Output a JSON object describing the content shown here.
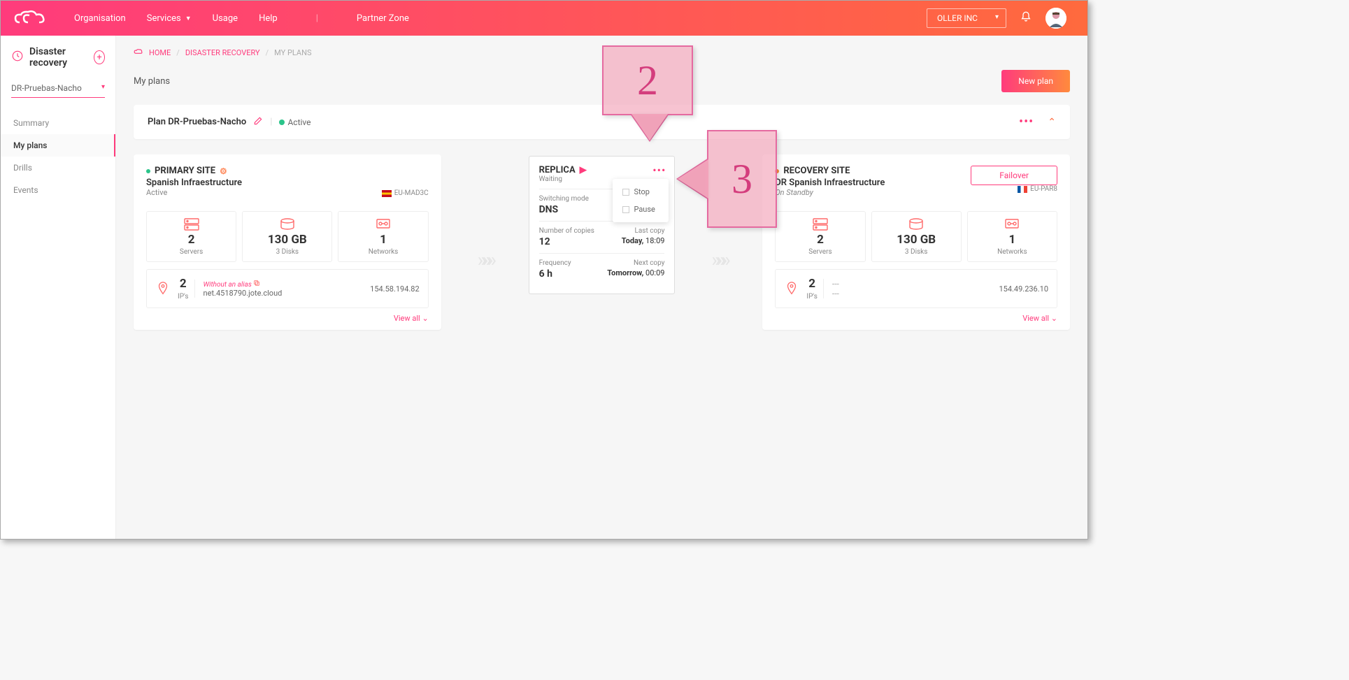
{
  "topbar": {
    "nav": {
      "org": "Organisation",
      "services": "Services",
      "usage": "Usage",
      "help": "Help",
      "partner": "Partner Zone"
    },
    "account": "OLLER INC"
  },
  "sidebar": {
    "title": "Disaster recovery",
    "selected_plan": "DR-Pruebas-Nacho",
    "menu": {
      "summary": "Summary",
      "my_plans": "My plans",
      "drills": "Drills",
      "events": "Events"
    }
  },
  "breadcrumb": {
    "home": "HOME",
    "dr": "DISASTER RECOVERY",
    "my_plans": "MY PLANS"
  },
  "page": {
    "title": "My plans",
    "new_plan_btn": "New plan"
  },
  "plan_header": {
    "label": "Plan DR-Pruebas-Nacho",
    "status": "Active"
  },
  "primary": {
    "label": "PRIMARY SITE",
    "subtitle": "Spanish Infraestructure",
    "state": "Active",
    "region": "EU-MAD3C",
    "metrics": {
      "servers_val": "2",
      "servers_lbl": "Servers",
      "disks_val": "130 GB",
      "disks_lbl": "3 Disks",
      "nets_val": "1",
      "nets_lbl": "Networks"
    },
    "ips": {
      "count": "2",
      "label": "IP's",
      "alias_lbl": "Without an alias",
      "alias_val": "net.4518790.jote.cloud",
      "addr": "154.58.194.82",
      "view_all": "View all"
    }
  },
  "replica": {
    "title": "REPLICA",
    "status": "Waiting",
    "switch_lbl": "Switching mode",
    "switch_val": "DNS",
    "copies_lbl": "Number of copies",
    "copies_val": "12",
    "last_lbl": "Last copy",
    "last_val_b": "Today,",
    "last_val": " 18:09",
    "freq_lbl": "Frequency",
    "freq_val": "6 h",
    "next_lbl": "Next copy",
    "next_val_b": "Tomorrow,",
    "next_val": " 00:09",
    "menu": {
      "stop": "Stop",
      "pause": "Pause"
    }
  },
  "recovery": {
    "label": "RECOVERY SITE",
    "subtitle": "DR Spanish Infraestructure",
    "state": "On Standby",
    "region": "EU-PAR8",
    "failover_btn": "Failover",
    "metrics": {
      "servers_val": "2",
      "servers_lbl": "Servers",
      "disks_val": "130 GB",
      "disks_lbl": "3 Disks",
      "nets_val": "1",
      "nets_lbl": "Networks"
    },
    "ips": {
      "count": "2",
      "label": "IP's",
      "dashes": "---",
      "addr": "154.49.236.10",
      "view_all": "View all"
    }
  },
  "callouts": {
    "n2": "2",
    "n3": "3"
  }
}
